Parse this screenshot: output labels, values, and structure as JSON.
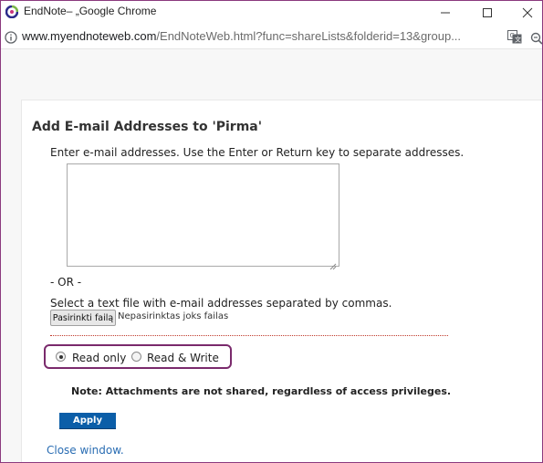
{
  "window": {
    "title": "EndNote– „Google Chrome"
  },
  "address_bar": {
    "domain": "www.myendnoteweb.com",
    "path": "/EndNoteWeb.html?func=shareLists&folderid=13&group..."
  },
  "dialog": {
    "heading": "Add E-mail Addresses to 'Pirma'",
    "instructions": "Enter e-mail addresses. Use the Enter or Return key to separate addresses.",
    "email_textarea_value": "",
    "or_text": "- OR -",
    "file_instructions": "Select a text file with e-mail addresses separated by commas.",
    "file_button_label": "Pasirinkti failą",
    "file_status": "Nepasirinktas joks failas",
    "access": {
      "selected": "read_only",
      "options": [
        {
          "id": "read_only",
          "label": "Read only"
        },
        {
          "id": "read_write",
          "label": "Read & Write"
        }
      ]
    },
    "note": "Note: Attachments are not shared, regardless of access privileges.",
    "apply_label": "Apply",
    "close_link": "Close window."
  },
  "colors": {
    "window_border": "#8b3a7e",
    "highlight_border": "#7a2a6c",
    "apply_button": "#0b5ea8",
    "link": "#2a6db3"
  },
  "icons": {
    "app": "endnote-logo-icon",
    "site_info": "info-icon",
    "translate": "translate-icon",
    "zoom": "zoom-icon",
    "minimize": "minimize-icon",
    "maximize": "maximize-icon",
    "close": "close-icon"
  }
}
